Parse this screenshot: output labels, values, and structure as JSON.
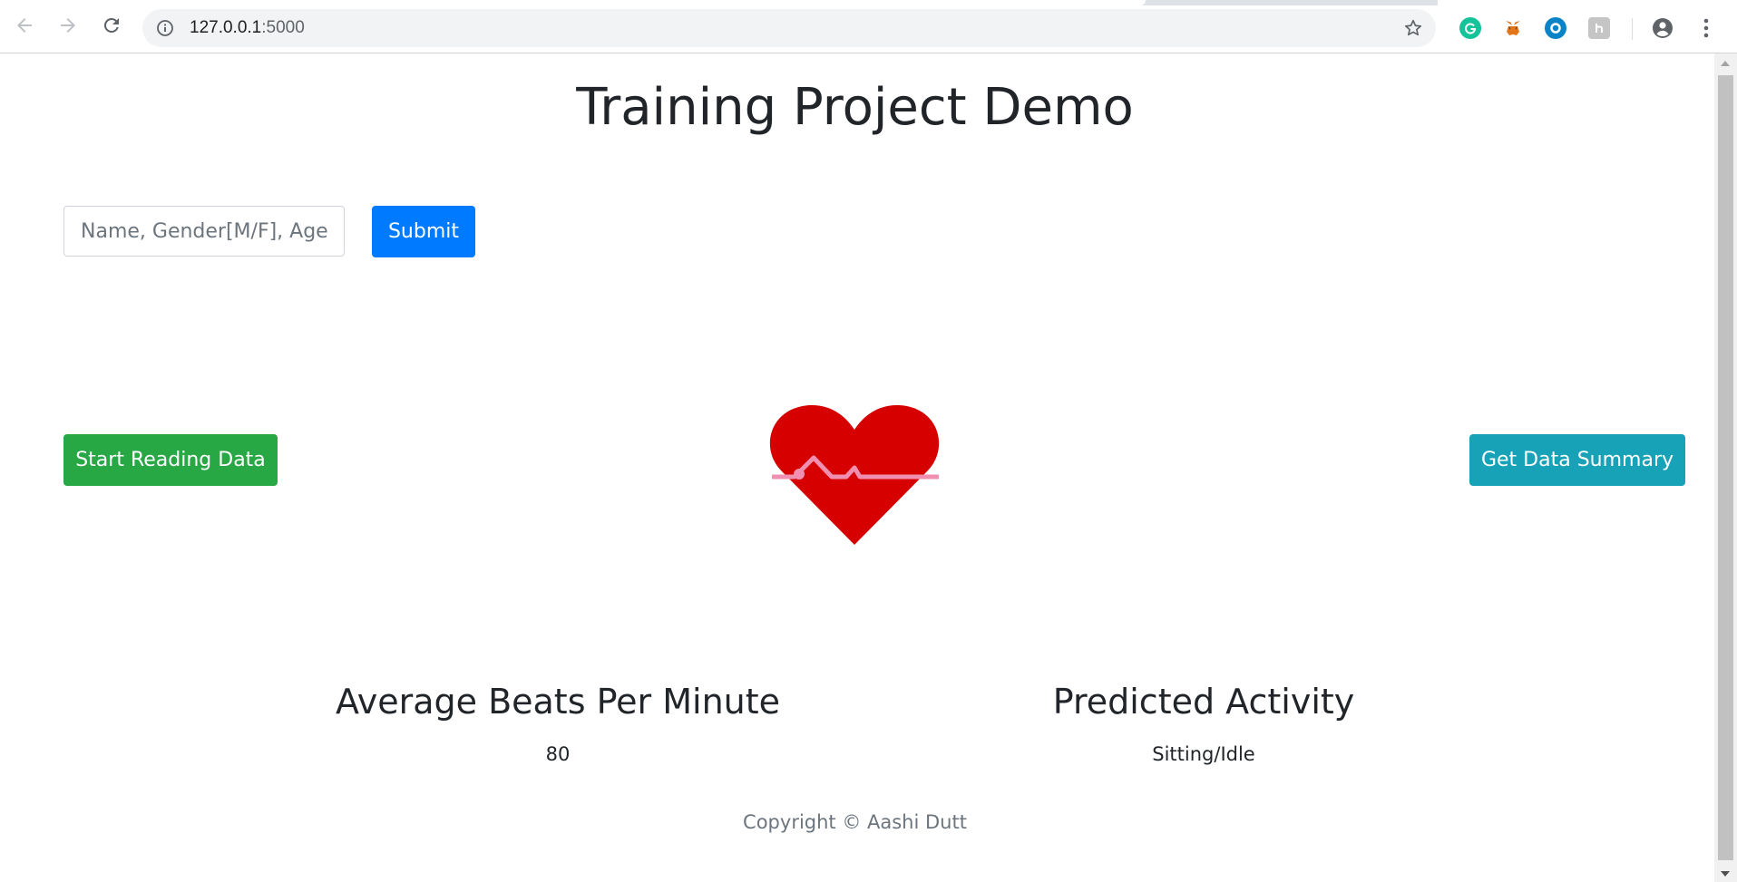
{
  "browser": {
    "url_host": "127.0.0.1",
    "url_port": ":5000",
    "extensions": [
      "grammarly-icon",
      "metamask-icon",
      "circle-extension-icon",
      "h-extension-icon"
    ]
  },
  "page": {
    "title": "Training Project Demo",
    "form": {
      "input_placeholder": "Name, Gender[M/F], Age",
      "submit_label": "Submit"
    },
    "buttons": {
      "start_label": "Start Reading Data",
      "summary_label": "Get Data Summary"
    },
    "stats": {
      "bpm_heading": "Average Beats Per Minute",
      "bpm_value": "80",
      "activity_heading": "Predicted Activity",
      "activity_value": "Sitting/Idle"
    },
    "footer": "Copyright © Aashi Dutt"
  },
  "colors": {
    "primary": "#007bff",
    "success": "#28a745",
    "info": "#17a2b8",
    "heart": "#d60000",
    "pulse": "#f08fb0"
  }
}
